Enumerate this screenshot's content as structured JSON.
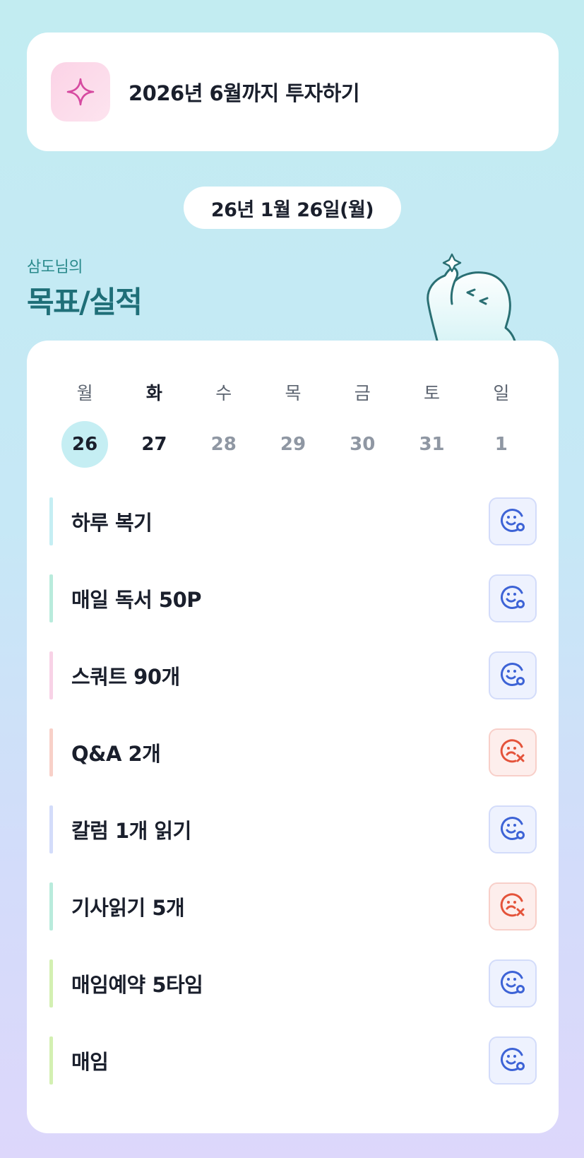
{
  "goal": {
    "title": "2026년 6월까지 투자하기",
    "icon": "sparkle-icon"
  },
  "date": {
    "label": "26년 1월 26일(월)"
  },
  "owner": {
    "name": "삼도님의",
    "title": "목표/실적"
  },
  "week": {
    "days": [
      {
        "label": "월",
        "num": "26"
      },
      {
        "label": "화",
        "num": "27"
      },
      {
        "label": "수",
        "num": "28"
      },
      {
        "label": "목",
        "num": "29"
      },
      {
        "label": "금",
        "num": "30"
      },
      {
        "label": "토",
        "num": "31"
      },
      {
        "label": "일",
        "num": "1"
      }
    ]
  },
  "tasks": [
    {
      "label": "하루 복기",
      "status": "done",
      "color": "#c5eef3"
    },
    {
      "label": "매일 독서 50P",
      "status": "done",
      "color": "#b9ebdc"
    },
    {
      "label": "스쿼트 90개",
      "status": "done",
      "color": "#f8d2e6"
    },
    {
      "label": "Q&A 2개",
      "status": "failed",
      "color": "#f8d0c8"
    },
    {
      "label": "칼럼 1개 읽기",
      "status": "done",
      "color": "#d3dcfa"
    },
    {
      "label": "기사읽기 5개",
      "status": "failed",
      "color": "#b9ebdc"
    },
    {
      "label": "매임예약 5타임",
      "status": "done",
      "color": "#d3f0b2"
    },
    {
      "label": "매임",
      "status": "done",
      "color": "#d3f0b2"
    }
  ],
  "colors": {
    "ok": "#3d63d6",
    "fail": "#e4533a",
    "accent": "#1f6f78"
  }
}
